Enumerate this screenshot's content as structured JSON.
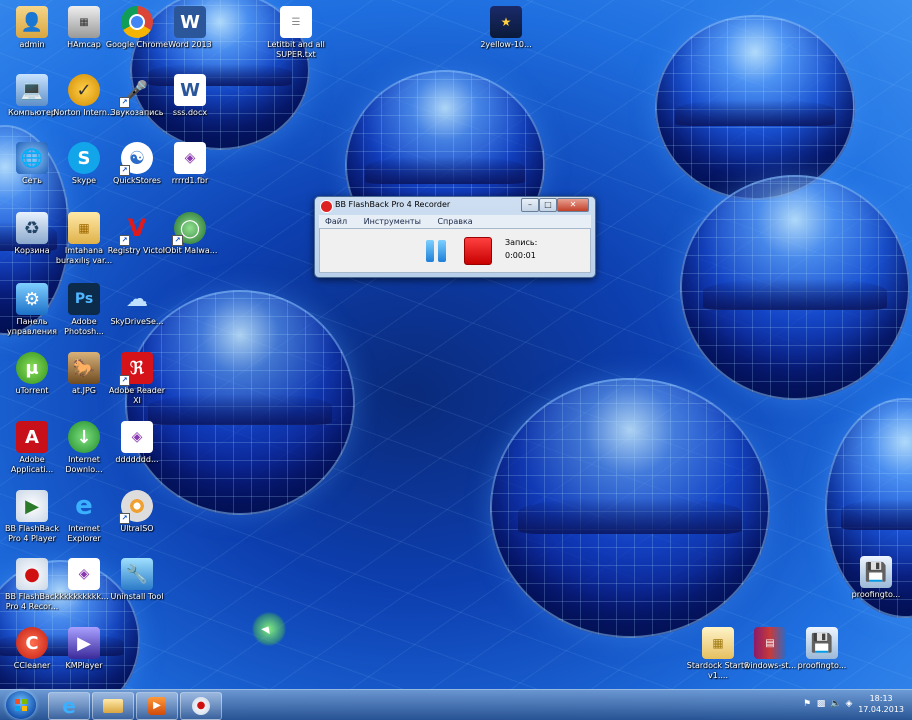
{
  "desktop_icons": [
    {
      "label": "admin",
      "icon": "user-folder-icon"
    },
    {
      "label": "HAmcap",
      "icon": "hamcap-icon"
    },
    {
      "label": "Google Chrome",
      "icon": "chrome-icon"
    },
    {
      "label": "Word 2013",
      "icon": "word-icon"
    },
    {
      "label": "Letitbit and all SUPER.txt",
      "icon": "text-file-icon"
    },
    {
      "label": "2yellow-10...",
      "icon": "image-file-icon"
    },
    {
      "label": "Компьютер",
      "icon": "computer-icon"
    },
    {
      "label": "Norton Intern...",
      "icon": "norton-icon"
    },
    {
      "label": "Звукозапись",
      "icon": "microphone-icon"
    },
    {
      "label": "sss.docx",
      "icon": "word-doc-icon"
    },
    {
      "label": "Сеть",
      "icon": "network-icon"
    },
    {
      "label": "Skype",
      "icon": "skype-icon"
    },
    {
      "label": "QuickStores",
      "icon": "quickstores-icon"
    },
    {
      "label": "rrrrd1.fbr",
      "icon": "fbr-file-icon"
    },
    {
      "label": "Корзина",
      "icon": "recycle-bin-icon"
    },
    {
      "label": "Imtahana buraxılış var...",
      "icon": "folder-icon"
    },
    {
      "label": "Registry Victor",
      "icon": "registry-icon"
    },
    {
      "label": "IObit Malwa...",
      "icon": "iobit-icon"
    },
    {
      "label": "Панель управления",
      "icon": "control-panel-icon"
    },
    {
      "label": "Adobe Photosh...",
      "icon": "photoshop-icon"
    },
    {
      "label": "SkyDriveSe...",
      "icon": "skydrive-icon"
    },
    {
      "label": "uTorrent",
      "icon": "utorrent-icon"
    },
    {
      "label": "at.JPG",
      "icon": "jpg-file-icon"
    },
    {
      "label": "Adobe Reader XI",
      "icon": "adobe-reader-icon"
    },
    {
      "label": "Adobe Applicati...",
      "icon": "adobe-app-icon"
    },
    {
      "label": "Internet Downlo...",
      "icon": "idm-icon"
    },
    {
      "label": "ddddddd...",
      "icon": "fbr-file-icon"
    },
    {
      "label": "BB FlashBack Pro 4 Player",
      "icon": "flashback-player-icon"
    },
    {
      "label": "Internet Explorer",
      "icon": "ie-icon"
    },
    {
      "label": "UltraISO",
      "icon": "ultraiso-icon"
    },
    {
      "label": "BB FlashBack Pro 4 Recor...",
      "icon": "flashback-recorder-icon"
    },
    {
      "label": "kkkkkkkkk...",
      "icon": "fbr-file-icon"
    },
    {
      "label": "Uninstall Tool",
      "icon": "uninstall-tool-icon"
    },
    {
      "label": "CCleaner",
      "icon": "ccleaner-icon"
    },
    {
      "label": "KMPlayer",
      "icon": "kmplayer-icon"
    },
    {
      "label": "proofingto...",
      "icon": "installer-icon"
    },
    {
      "label": "Stardock Start8 v1....",
      "icon": "folder-icon"
    },
    {
      "label": "windows-st...",
      "icon": "winrar-icon"
    },
    {
      "label": "proofingto...",
      "icon": "installer-icon"
    }
  ],
  "recorder": {
    "title": "BB FlashBack Pro 4 Recorder",
    "menu": [
      "Файл",
      "Инструменты",
      "Справка"
    ],
    "record_label": "Запись:",
    "elapsed": "0:00:01"
  },
  "taskbar": {
    "time": "18:13",
    "date": "17.04.2013",
    "pinned": [
      "internet-explorer-icon",
      "explorer-folder-icon",
      "media-player-icon",
      "flashback-recorder-icon"
    ]
  },
  "colors": {
    "accent": "#1f6fe0",
    "stop": "#e01010",
    "pause": "#3aa4f0"
  }
}
